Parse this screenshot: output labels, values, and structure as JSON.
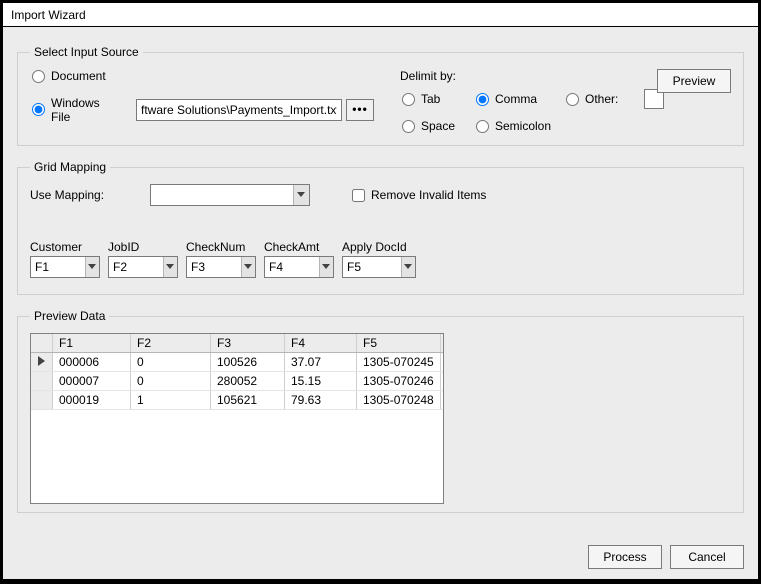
{
  "window": {
    "title": "Import Wizard"
  },
  "source": {
    "legend": "Select Input Source",
    "document_label": "Document",
    "windows_file_label": "Windows File",
    "selected": "windows_file",
    "file_path": "ftware Solutions\\Payments_Import.txt",
    "browse_glyph": "•••",
    "delimit_label": "Delimit by:",
    "delimiters": {
      "tab": "Tab",
      "comma": "Comma",
      "other": "Other:",
      "space": "Space",
      "semicolon": "Semicolon",
      "selected": "comma",
      "other_value": ""
    },
    "preview_button": "Preview"
  },
  "mapping": {
    "legend": "Grid Mapping",
    "use_mapping_label": "Use Mapping:",
    "use_mapping_value": "",
    "remove_invalid_label": "Remove Invalid Items",
    "remove_invalid_checked": false,
    "columns": [
      {
        "header": "Customer",
        "value": "F1"
      },
      {
        "header": "JobID",
        "value": "F2"
      },
      {
        "header": "CheckNum",
        "value": "F3"
      },
      {
        "header": "CheckAmt",
        "value": "F4"
      },
      {
        "header": "Apply DocId",
        "value": "F5"
      }
    ]
  },
  "preview": {
    "legend": "Preview Data",
    "headers": [
      "F1",
      "F2",
      "F3",
      "F4",
      "F5"
    ],
    "rows": [
      {
        "current": true,
        "cells": [
          "000006",
          "0",
          "100526",
          "37.07",
          "1305-070245"
        ]
      },
      {
        "current": false,
        "cells": [
          "000007",
          "0",
          "280052",
          "15.15",
          "1305-070246"
        ]
      },
      {
        "current": false,
        "cells": [
          "000019",
          "1",
          "105621",
          "79.63",
          "1305-070248"
        ]
      }
    ]
  },
  "buttons": {
    "process": "Process",
    "cancel": "Cancel"
  }
}
